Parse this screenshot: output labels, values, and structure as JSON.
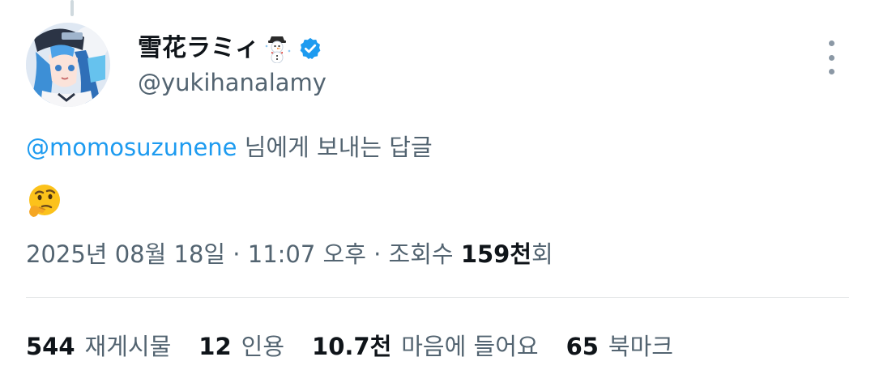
{
  "author": {
    "display_name": "雪花ラミィ",
    "handle": "@yukihanalamy",
    "name_emoji_icon": "snowman-icon",
    "verified_icon": "verified-badge-icon",
    "avatar_icon": "profile-avatar"
  },
  "reply_context": {
    "mention": "@momosuzunene",
    "text": " 님에게 보내는 답글"
  },
  "tweet": {
    "content_emoji_icon": "thinking-face-emoji"
  },
  "meta": {
    "datetime": "2025년 08월 18일 · 11:07 오후 · 조회수 ",
    "views_value": "159천",
    "views_suffix": "회"
  },
  "stats": {
    "retweets_value": "544",
    "retweets_label": "재게시물",
    "quotes_value": "12",
    "quotes_label": "인용",
    "likes_value": "10.7천",
    "likes_label": "마음에 들어요",
    "bookmarks_value": "65",
    "bookmarks_label": "북마크"
  },
  "colors": {
    "link": "#1d9bf0",
    "secondary_text": "#536471",
    "primary_text": "#0f1419",
    "divider": "#e7e9ea"
  }
}
